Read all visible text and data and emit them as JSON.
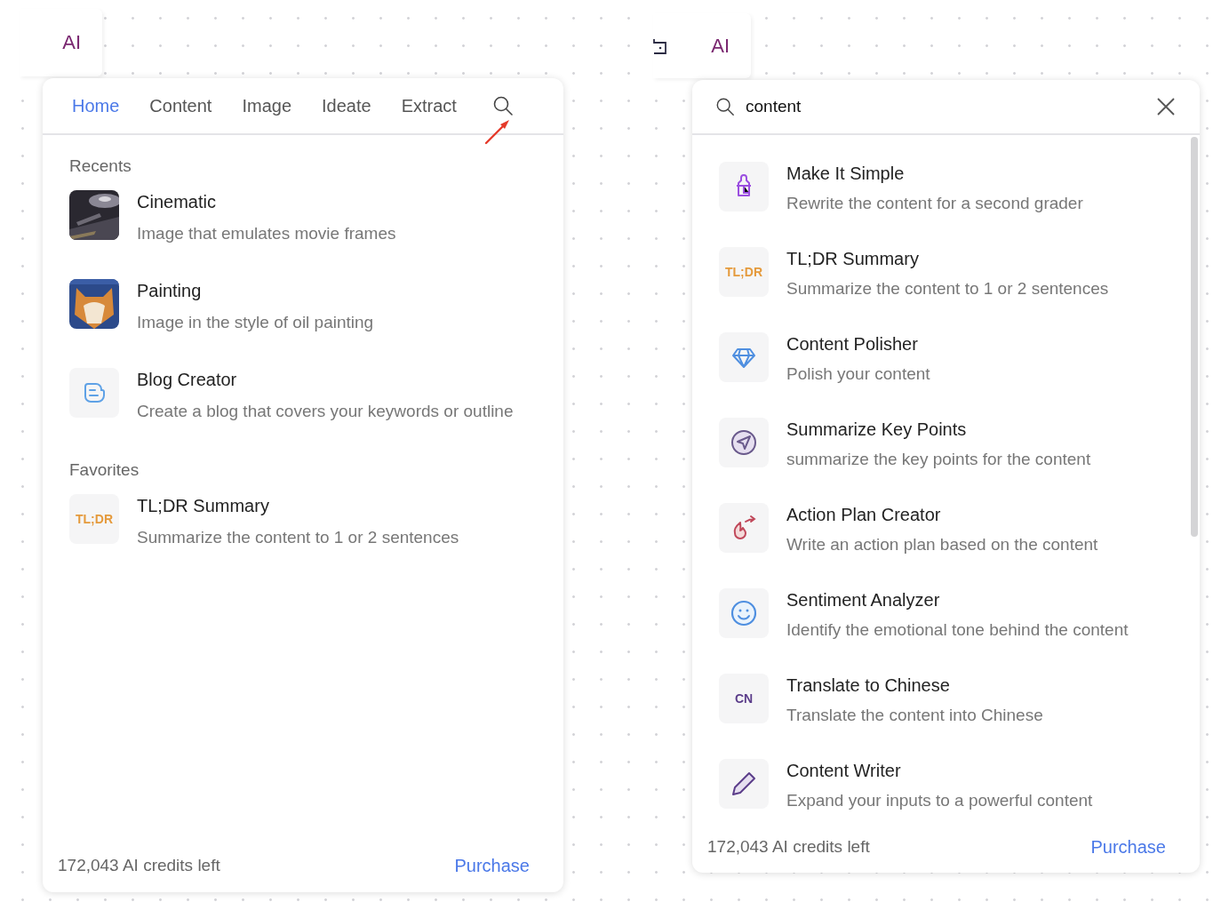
{
  "left": {
    "toolbar": {
      "label": "AI"
    },
    "tabs": [
      {
        "label": "Home",
        "selected": true
      },
      {
        "label": "Content",
        "selected": false
      },
      {
        "label": "Image",
        "selected": false
      },
      {
        "label": "Ideate",
        "selected": false
      },
      {
        "label": "Extract",
        "selected": false
      }
    ],
    "sections": [
      {
        "title": "Recents",
        "items": [
          {
            "kind": "film",
            "title": "Cinematic",
            "description": "Image that emulates movie frames"
          },
          {
            "kind": "painting",
            "title": "Painting",
            "description": "Image in the style of oil painting"
          },
          {
            "kind": "blog",
            "title": "Blog Creator",
            "description": "Create a blog that covers your keywords or outline"
          }
        ]
      },
      {
        "title": "Favorites",
        "items": [
          {
            "kind": "text",
            "icon_text": "TL;DR",
            "color": "#e59a3c",
            "title": "TL;DR Summary",
            "description": "Summarize the content to 1 or 2 sentences"
          }
        ]
      }
    ],
    "footer": {
      "credits": "172,043 AI credits left",
      "link": "Purchase"
    }
  },
  "right": {
    "toolbar": {
      "label": "AI"
    },
    "search": {
      "value": "content"
    },
    "items": [
      {
        "kind": "bottle",
        "title": "Make It Simple",
        "description": "Rewrite the content for a second grader"
      },
      {
        "kind": "text",
        "icon_text": "TL;DR",
        "color": "#e59a3c",
        "title": "TL;DR Summary",
        "description": "Summarize the content to 1 or 2 sentences"
      },
      {
        "kind": "gem",
        "title": "Content Polisher",
        "description": "Polish your content"
      },
      {
        "kind": "send",
        "title": "Summarize Key Points",
        "description": "summarize the key points for the content"
      },
      {
        "kind": "flame",
        "title": "Action Plan Creator",
        "description": "Write an action plan based on the content"
      },
      {
        "kind": "smile",
        "title": "Sentiment Analyzer",
        "description": "Identify the emotional tone behind the content"
      },
      {
        "kind": "text",
        "icon_text": "CN",
        "color": "#5b3d8a",
        "title": "Translate to Chinese",
        "description": "Translate the content into Chinese"
      },
      {
        "kind": "pencil",
        "title": "Content Writer",
        "description": "Expand your inputs to a powerful content"
      }
    ],
    "footer": {
      "credits": "172,043 AI credits left",
      "link": "Purchase"
    }
  }
}
